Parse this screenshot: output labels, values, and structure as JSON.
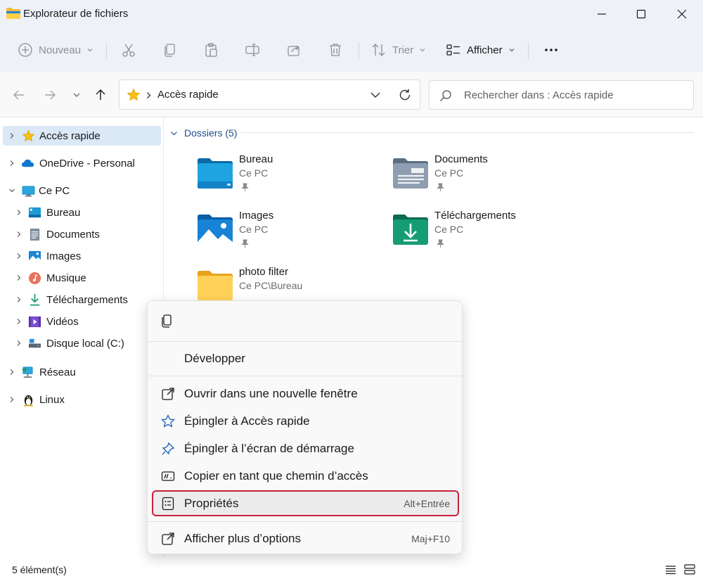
{
  "window": {
    "title": "Explorateur de fichiers",
    "icons": {
      "app": "folder-icon",
      "minimize": "minimize-icon",
      "maximize": "maximize-icon",
      "close": "close-icon"
    }
  },
  "toolbar": {
    "new_label": "Nouveau",
    "sort_label": "Trier",
    "view_label": "Afficher",
    "icons": [
      "new-icon",
      "cut-icon",
      "copy-icon",
      "paste-icon",
      "rename-icon",
      "share-icon",
      "delete-icon",
      "sort-icon",
      "view-icon",
      "more-icon"
    ]
  },
  "address": {
    "crumb": "Accès rapide",
    "search_placeholder": "Rechercher dans : Accès rapide"
  },
  "sidebar": {
    "items": [
      {
        "label": "Accès rapide",
        "icon": "star-icon"
      },
      {
        "label": "OneDrive - Personal",
        "icon": "cloud-icon"
      },
      {
        "label": "Ce PC",
        "icon": "monitor-icon"
      },
      {
        "label": "Bureau",
        "icon": "desktop-icon"
      },
      {
        "label": "Documents",
        "icon": "documents-icon"
      },
      {
        "label": "Images",
        "icon": "images-icon"
      },
      {
        "label": "Musique",
        "icon": "music-icon"
      },
      {
        "label": "Téléchargements",
        "icon": "download-icon"
      },
      {
        "label": "Vidéos",
        "icon": "videos-icon"
      },
      {
        "label": "Disque local (C:)",
        "icon": "drive-icon"
      },
      {
        "label": "Réseau",
        "icon": "network-icon"
      },
      {
        "label": "Linux",
        "icon": "linux-icon"
      }
    ]
  },
  "content": {
    "section_title": "Dossiers (5)",
    "folders": [
      {
        "name": "Bureau",
        "location": "Ce PC",
        "pinned": true
      },
      {
        "name": "Documents",
        "location": "Ce PC",
        "pinned": true
      },
      {
        "name": "Images",
        "location": "Ce PC",
        "pinned": true
      },
      {
        "name": "Téléchargements",
        "location": "Ce PC",
        "pinned": true
      },
      {
        "name": "photo filter",
        "location": "Ce PC\\Bureau",
        "pinned": false
      }
    ]
  },
  "context_menu": {
    "items": [
      {
        "label": "Développer"
      },
      {
        "label": "Ouvrir dans une nouvelle fenêtre",
        "icon": "open-new-window-icon"
      },
      {
        "label": "Épingler à Accès rapide",
        "icon": "star-outline-icon"
      },
      {
        "label": "Épingler à l’écran de démarrage",
        "icon": "pin-icon"
      },
      {
        "label": "Copier en tant que chemin d’accès",
        "icon": "copy-path-icon"
      },
      {
        "label": "Propriétés",
        "shortcut": "Alt+Entrée",
        "icon": "properties-icon",
        "highlighted": true
      },
      {
        "label": "Afficher plus d’options",
        "shortcut": "Maj+F10",
        "icon": "more-options-icon"
      }
    ]
  },
  "status": {
    "item_count": "5 élément(s)"
  },
  "colors": {
    "accent": "#0067c0",
    "highlight_border": "#c8203a",
    "selection": "#dbe8f6",
    "chrome": "#eef2f8"
  }
}
